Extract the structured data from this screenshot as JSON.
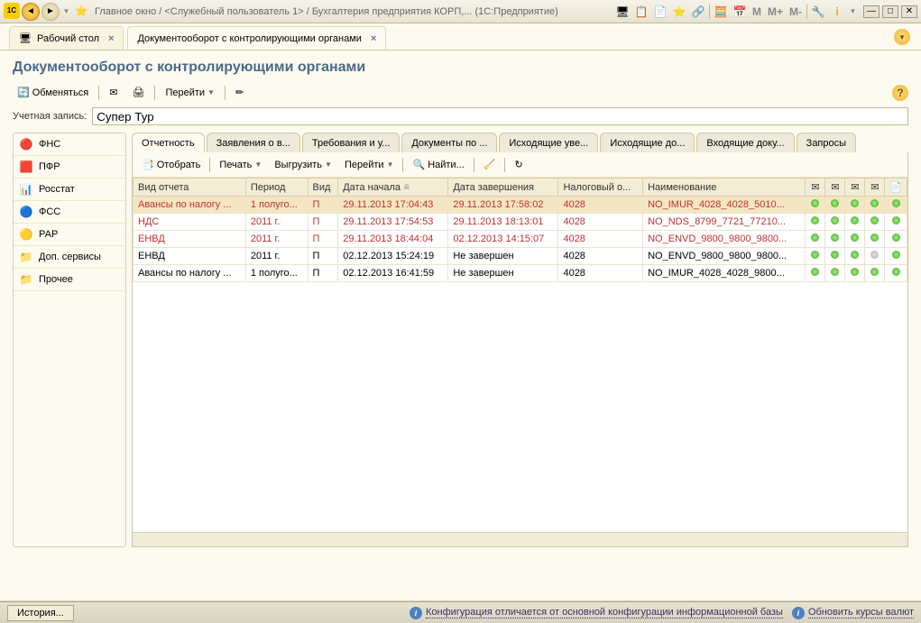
{
  "titlebar": {
    "text": "Главное окно / <Служебный пользователь 1> / Бухгалтерия предприятия КОРП,... (1С:Предприятие)",
    "mem": [
      "M",
      "M+",
      "M-"
    ]
  },
  "main_tabs": [
    {
      "label": "Рабочий стол"
    },
    {
      "label": "Документооборот с контролирующими органами"
    }
  ],
  "page_title": "Документооборот с контролирующими органами",
  "toolbar1": {
    "exchange": "Обменяться",
    "go": "Перейти"
  },
  "account": {
    "label": "Учетная запись:",
    "value": "Супер Тур"
  },
  "sidebar": [
    {
      "icon": "🔴",
      "label": "ФНС"
    },
    {
      "icon": "🟥",
      "label": "ПФР"
    },
    {
      "icon": "📊",
      "label": "Росстат"
    },
    {
      "icon": "🔵",
      "label": "ФСС"
    },
    {
      "icon": "🟡",
      "label": "РАР"
    },
    {
      "icon": "📁",
      "label": "Доп. сервисы"
    },
    {
      "icon": "📁",
      "label": "Прочее"
    }
  ],
  "inner_tabs": [
    "Отчетность",
    "Заявления о в...",
    "Требования и у...",
    "Документы по ...",
    "Исходящие уве...",
    "Исходящие до...",
    "Входящие доку...",
    "Запросы"
  ],
  "toolbar2": {
    "filter": "Отобрать",
    "print": "Печать",
    "export": "Выгрузить",
    "go": "Перейти",
    "find": "Найти..."
  },
  "table": {
    "headers": [
      "Вид отчета",
      "Период",
      "Вид",
      "Дата начала",
      "Дата завершения",
      "Налоговый о...",
      "Наименование"
    ],
    "rows": [
      {
        "sel": true,
        "red": true,
        "cells": [
          "Авансы по налогу ...",
          "1 полуго...",
          "П",
          "29.11.2013 17:04:43",
          "29.11.2013 17:58:02",
          "4028",
          "NO_IMUR_4028_4028_5010..."
        ],
        "dots": [
          "g",
          "g",
          "g",
          "g",
          "g"
        ]
      },
      {
        "red": true,
        "cells": [
          "НДС",
          "2011 г.",
          "П",
          "29.11.2013 17:54:53",
          "29.11.2013 18:13:01",
          "4028",
          "NO_NDS_8799_7721_77210..."
        ],
        "dots": [
          "g",
          "g",
          "g",
          "g",
          "g"
        ]
      },
      {
        "red": true,
        "cells": [
          "ЕНВД",
          "2011 г.",
          "П",
          "29.11.2013 18:44:04",
          "02.12.2013 14:15:07",
          "4028",
          "NO_ENVD_9800_9800_9800..."
        ],
        "dots": [
          "g",
          "g",
          "g",
          "g",
          "g"
        ]
      },
      {
        "cells": [
          "ЕНВД",
          "2011 г.",
          "П",
          "02.12.2013 15:24:19",
          "Не завершен",
          "4028",
          "NO_ENVD_9800_9800_9800..."
        ],
        "dots": [
          "g",
          "g",
          "g",
          "x",
          "g"
        ]
      },
      {
        "cells": [
          "Авансы по налогу ...",
          "1 полуго...",
          "П",
          "02.12.2013 16:41:59",
          "Не завершен",
          "4028",
          "NO_IMUR_4028_4028_9800..."
        ],
        "dots": [
          "g",
          "g",
          "g",
          "g",
          "g"
        ]
      }
    ]
  },
  "statusbar": {
    "history": "История...",
    "msg1": "Конфигурация отличается от основной конфигурации информационной базы",
    "msg2": "Обновить курсы валют"
  }
}
